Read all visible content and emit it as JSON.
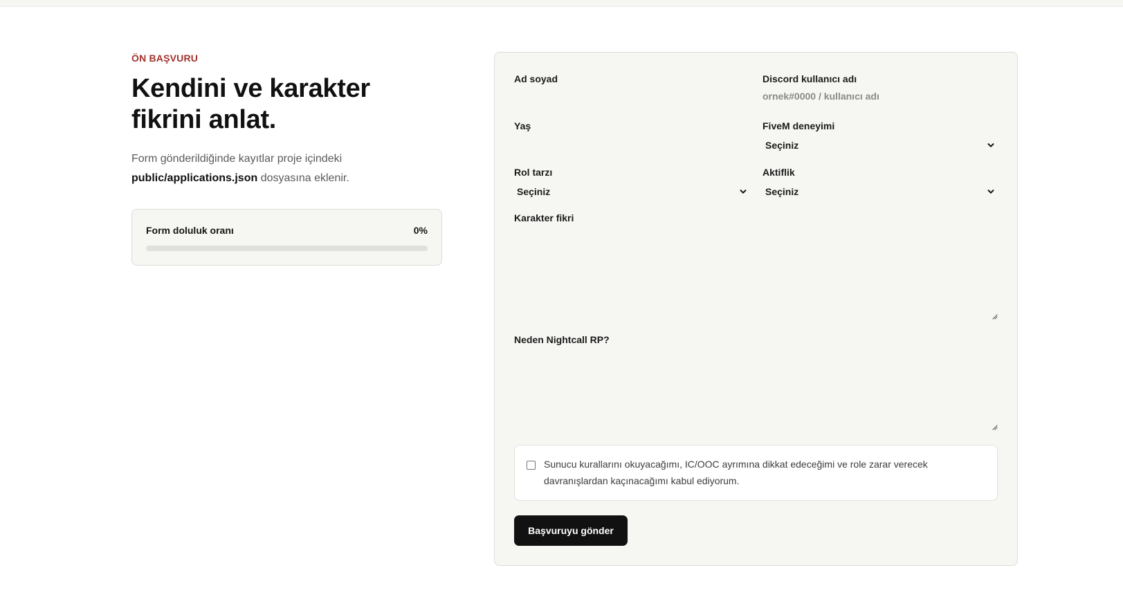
{
  "intro": {
    "eyebrow": "ÖN BAŞVURU",
    "heading": "Kendini ve karakter fikrini anlat.",
    "lead_before": "Form gönderildiğinde kayıtlar proje içindeki",
    "lead_file": "public/applications.json",
    "lead_after": "dosyasına eklenir."
  },
  "progress": {
    "label": "Form doluluk oranı",
    "value_text": "0%",
    "value": 0
  },
  "form": {
    "ad_soyad": {
      "label": "Ad soyad",
      "value": "",
      "placeholder": ""
    },
    "discord": {
      "label": "Discord kullanıcı adı",
      "value": "",
      "placeholder": "ornek#0000 / kullanıcı adı"
    },
    "yas": {
      "label": "Yaş",
      "value": "",
      "placeholder": ""
    },
    "fivem": {
      "label": "FiveM deneyimi",
      "selected": "Seçiniz"
    },
    "rol_tarzi": {
      "label": "Rol tarzı",
      "selected": "Seçiniz"
    },
    "aktiflik": {
      "label": "Aktiflik",
      "selected": "Seçiniz"
    },
    "karakter_fikri": {
      "label": "Karakter fikri",
      "value": ""
    },
    "neden": {
      "label": "Neden Nightcall RP?",
      "value": ""
    },
    "consent_text": "Sunucu kurallarını okuyacağımı, IC/OOC ayrımına dikkat edeceğimi ve role zarar verecek davranışlardan kaçınacağımı kabul ediyorum.",
    "consent_checked": false,
    "submit_label": "Başvuruyu gönder"
  },
  "icons": {
    "select_arrow": "chevron-down-icon",
    "textarea_resize": "resize-handle-icon"
  },
  "colors": {
    "accent": "#a3322d",
    "button": "#111111",
    "card_bg": "#f6f6f3"
  }
}
